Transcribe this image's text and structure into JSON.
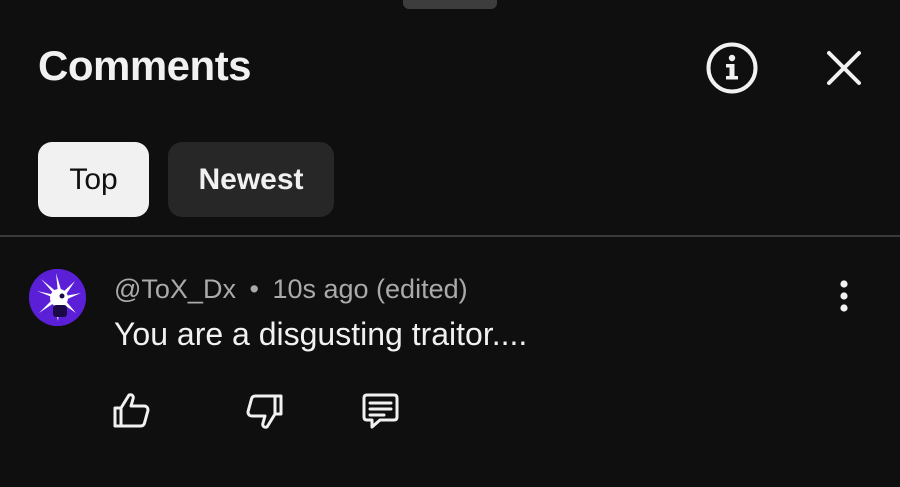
{
  "sheet": {
    "title": "Comments",
    "info_icon": "info-circle-icon",
    "close_icon": "close-icon"
  },
  "filters": {
    "top_label": "Top",
    "newest_label": "Newest",
    "selected": "Top"
  },
  "comments": [
    {
      "author": "@ToX_Dx",
      "separator": "•",
      "time": "10s ago",
      "edited": "(edited)",
      "text": "You are a disgusting traitor....",
      "avatar_color": "#5a1fd6",
      "actions": [
        "thumbs-up-icon",
        "thumbs-down-icon",
        "reply-icon"
      ],
      "menu_icon": "more-vertical-icon"
    }
  ],
  "colors": {
    "background": "#0f0f0f",
    "chip_selected": "#f1f1f1",
    "chip_unselected": "#272727",
    "text_primary": "#f1f1f1",
    "text_secondary": "#aaaaaa"
  }
}
